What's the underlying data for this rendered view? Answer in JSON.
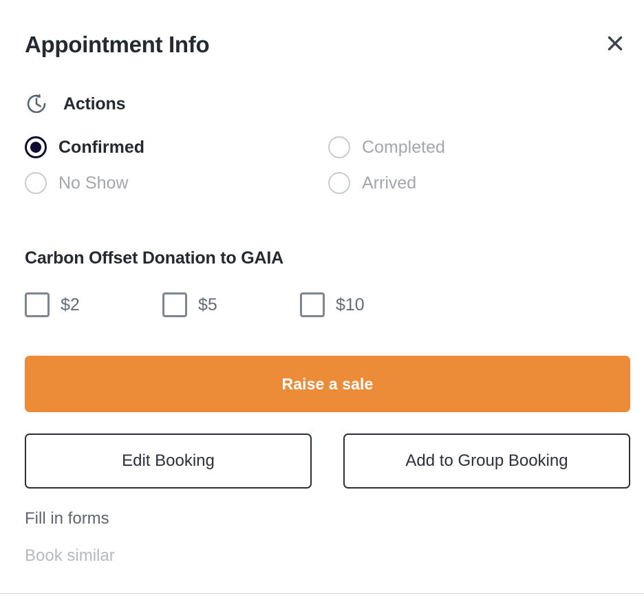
{
  "header": {
    "title": "Appointment Info",
    "close_icon": "close-icon"
  },
  "actions": {
    "icon": "history-clock-icon",
    "label": "Actions",
    "statuses": [
      {
        "label": "Confirmed",
        "selected": true
      },
      {
        "label": "Completed",
        "selected": false
      },
      {
        "label": "No Show",
        "selected": false
      },
      {
        "label": "Arrived",
        "selected": false
      }
    ]
  },
  "donation": {
    "title": "Carbon Offset Donation to GAIA",
    "options": [
      {
        "label": "$2",
        "checked": false
      },
      {
        "label": "$5",
        "checked": false
      },
      {
        "label": "$10",
        "checked": false
      }
    ]
  },
  "primary_action": {
    "label": "Raise a sale"
  },
  "secondary_actions": [
    {
      "label": "Edit Booking"
    },
    {
      "label": "Add to Group Booking"
    }
  ],
  "links": [
    {
      "label": "Fill in forms",
      "muted": false
    },
    {
      "label": "Book similar",
      "muted": true
    }
  ],
  "colors": {
    "primary_button": "#ec8c38",
    "title_text": "#242a31",
    "selected_radio": "#0d0d33",
    "muted_text": "#b6b9c0",
    "checkbox_border": "#7c8591",
    "divider": "#d7dae0"
  }
}
